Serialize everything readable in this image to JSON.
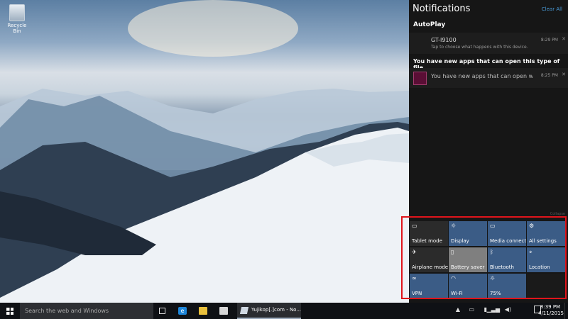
{
  "desktop": {
    "recycle_bin_label": "Recycle Bin"
  },
  "notifications": {
    "title": "Notifications",
    "clear_all": "Clear All",
    "groups": [
      {
        "header": "AutoPlay",
        "items": [
          {
            "title": "GT-I9100",
            "subtitle": "Tap to choose what happens with this device.",
            "time": "8:29 PM"
          }
        ]
      },
      {
        "header": "You have new apps that can open this type of file.",
        "items": [
          {
            "title": "You have new apps that can open we",
            "time": "8:25 PM"
          }
        ]
      }
    ],
    "collapse_label": "Collapse"
  },
  "quick_actions": [
    {
      "label": "Tablet mode",
      "icon": "tablet-icon",
      "state": "off"
    },
    {
      "label": "Display",
      "icon": "brightness-icon",
      "state": "on"
    },
    {
      "label": "Media connect",
      "icon": "media-connect-icon",
      "state": "on"
    },
    {
      "label": "All settings",
      "icon": "gear-icon",
      "state": "on"
    },
    {
      "label": "Airplane mode",
      "icon": "airplane-icon",
      "state": "off"
    },
    {
      "label": "Battery saver",
      "icon": "battery-saver-icon",
      "state": "saver"
    },
    {
      "label": "Bluetooth",
      "icon": "bluetooth-icon",
      "state": "on"
    },
    {
      "label": "Location",
      "icon": "location-icon",
      "state": "on"
    },
    {
      "label": "VPN",
      "icon": "vpn-icon",
      "state": "on"
    },
    {
      "label": "Wi-Fi",
      "icon": "wifi-icon",
      "state": "on"
    },
    {
      "label": "75%",
      "icon": "brightness-icon",
      "state": "on"
    }
  ],
  "taskbar": {
    "search_placeholder": "Search the web and Windows",
    "running_app_label": "Yujikop[.]com - No...",
    "clock_time": "8:39 PM",
    "clock_date": "4/11/2015"
  },
  "colors": {
    "tile_on": "#3b5c86",
    "tile_off": "#2b2b2b",
    "highlight": "#e0141b",
    "link_blue": "#4a9bd8"
  }
}
